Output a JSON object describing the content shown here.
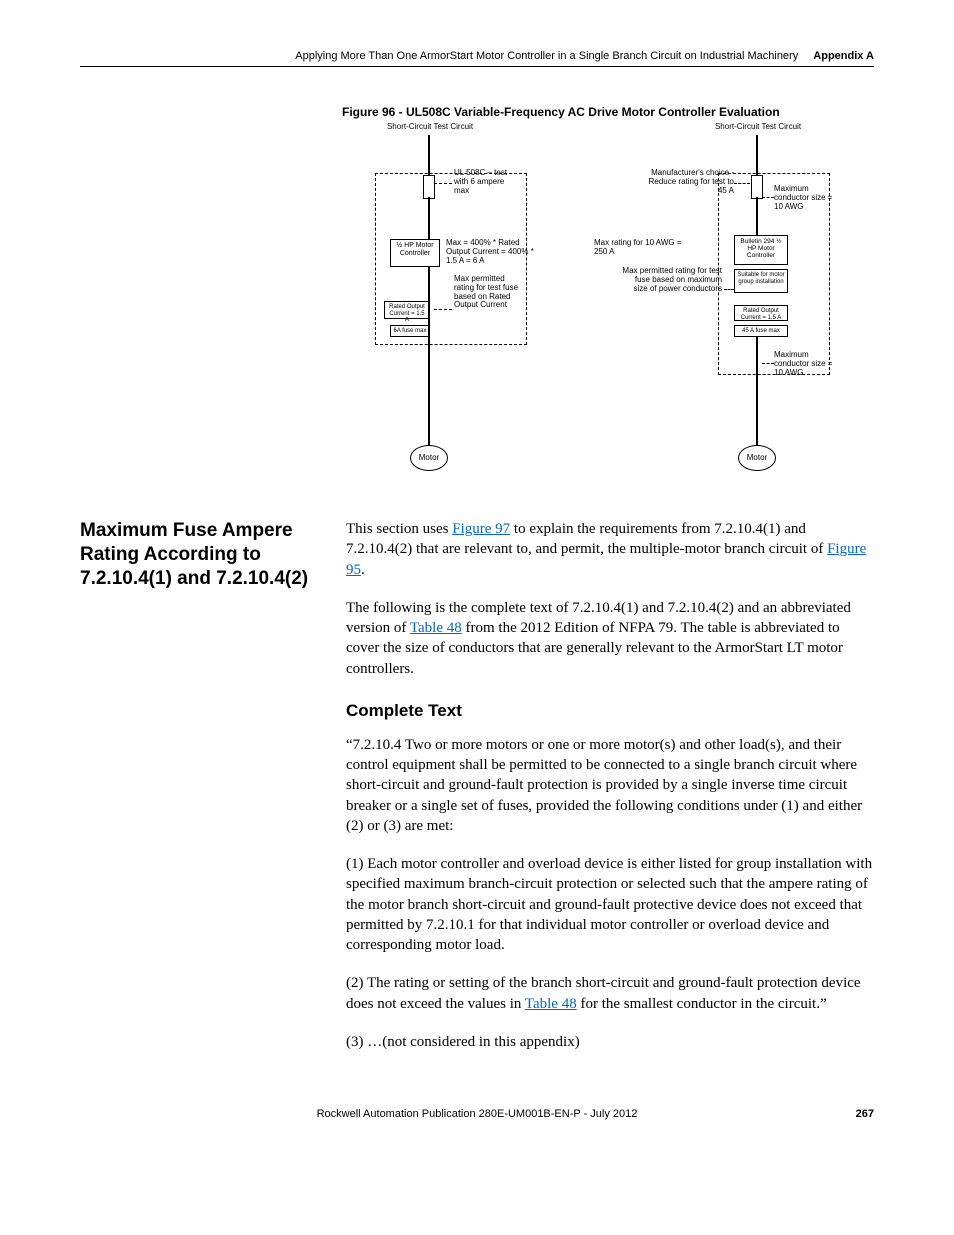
{
  "header": {
    "running_title": "Applying More Than One ArmorStart Motor Controller in a Single Branch Circuit on Industrial Machinery",
    "appendix": "Appendix A"
  },
  "figure": {
    "caption": "Figure 96 - UL508C Variable-Frequency AC Drive Motor Controller Evaluation",
    "left": {
      "top_label": "Short-Circuit Test Circuit",
      "note_ul": "UL 508C – test with 6 ampere max",
      "controller": "½ HP Motor Controller",
      "max_calc": "Max = 400% * Rated Output Current = 400% * 1.5 A = 6 A",
      "permitted": "Max permitted rating for test fuse based on Rated Output Current",
      "rated_output": "Rated Output Current = 1.5 A",
      "fuse_max": "6A fuse max",
      "motor": "Motor"
    },
    "right": {
      "top_label": "Short-Circuit Test Circuit",
      "note_mfg": "Manufacturer's choice - Reduce rating for test to 45 A",
      "max_cond1": "Maximum conductor size = 10 AWG",
      "max_10awg": "Max rating for 10 AWG = 250 A",
      "controller": "Bulletin 294 ½ HP Motor Controller",
      "suitable": "Suitable for motor group installation",
      "permitted": "Max permitted rating for test fuse based on maximum size of power conductors",
      "rated_output": "Rated Output Current = 1.5 A",
      "fuse_max": "45 A fuse max",
      "max_cond2": "Maximum conductor size = 10 AWG",
      "motor": "Motor"
    }
  },
  "section": {
    "title": "Maximum Fuse Ampere Rating According to 7.2.10.4(1) and 7.2.10.4(2)",
    "para1_a": "This section uses ",
    "para1_link1": "Figure 97",
    "para1_b": " to explain the requirements from 7.2.10.4(1) and 7.2.10.4(2) that are relevant to, and permit, the multiple-motor branch circuit of ",
    "para1_link2": "Figure 95",
    "para1_c": ".",
    "para2_a": "The following is the complete text of 7.2.10.4(1) and 7.2.10.4(2) and an abbreviated version of ",
    "para2_link": "Table 48",
    "para2_b": " from the 2012 Edition of NFPA 79. The table is abbreviated to cover the size of conductors that are generally relevant to the ArmorStart LT motor controllers.",
    "subhead": "Complete Text",
    "quote1": " “7.2.10.4 Two or more motors or one or more motor(s) and other load(s), and their control equipment shall be permitted to be connected to a single branch circuit where short-circuit and ground-fault protection is provided by a single inverse time circuit breaker or a single set of fuses, provided the following conditions under (1) and either (2) or (3) are met:",
    "quote2": "(1) Each motor controller and overload device is either listed for group installation with specified maximum branch-circuit protection or selected such that the ampere rating of the motor branch short-circuit and ground-fault protective device does not exceed that permitted by 7.2.10.1 for that individual motor controller or overload device and corresponding motor load.",
    "quote3_a": "(2) The rating or setting of the branch short-circuit and ground-fault protection device does not exceed the values in ",
    "quote3_link": "Table 48",
    "quote3_b": " for the smallest conductor in the circuit.”",
    "quote4": "(3) …(not considered in this appendix)"
  },
  "footer": {
    "pub": "Rockwell Automation Publication 280E-UM001B-EN-P - July 2012",
    "page": "267"
  }
}
